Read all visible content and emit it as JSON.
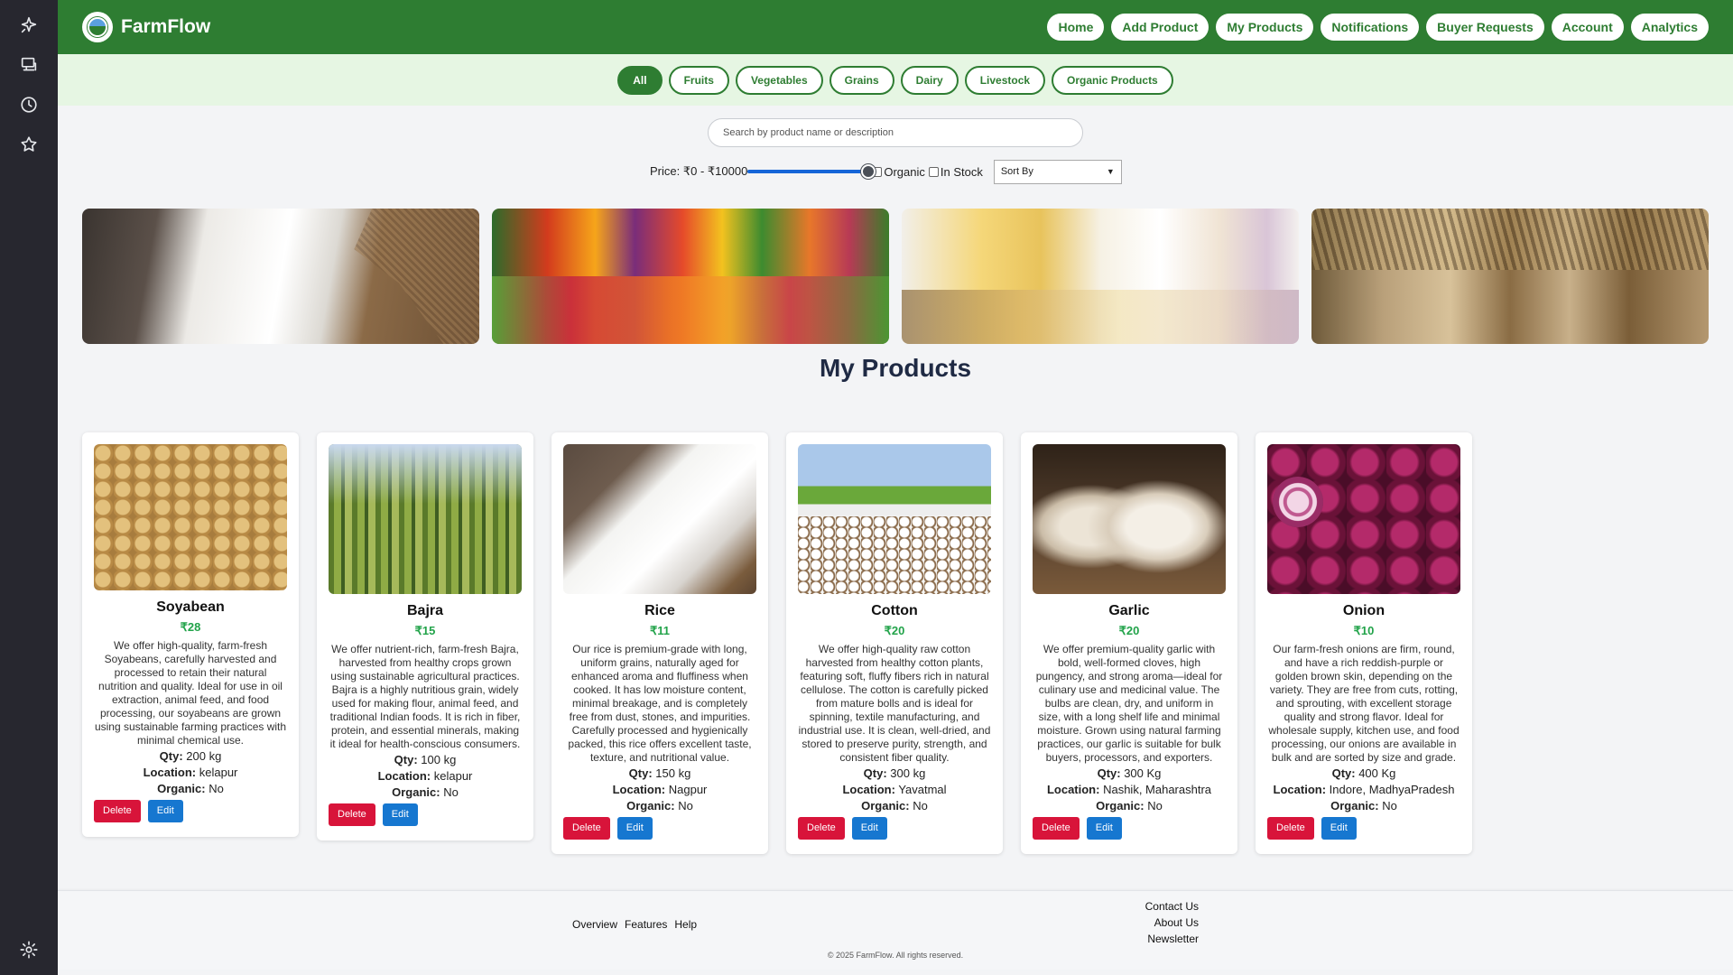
{
  "rail": {
    "icons": [
      "sparkle-icon",
      "monitor-icon",
      "clock-icon",
      "star-icon",
      "gear-icon"
    ]
  },
  "header": {
    "brand": "FarmFlow",
    "nav": [
      "Home",
      "Add Product",
      "My Products",
      "Notifications",
      "Buyer Requests",
      "Account",
      "Analytics"
    ]
  },
  "categories": {
    "items": [
      "All",
      "Fruits",
      "Vegetables",
      "Grains",
      "Dairy",
      "Livestock",
      "Organic Products"
    ],
    "active": "All"
  },
  "search": {
    "placeholder": "Search by product name or description"
  },
  "filters": {
    "price_label": "Price: ₹0 - ₹10000",
    "price_slider_value_fraction": 1.0,
    "organic_label": "Organic",
    "organic_checked": false,
    "instock_label": "In Stock",
    "instock_checked": false,
    "sort_value": "Sort By"
  },
  "banners": [
    "rice",
    "vegetables",
    "dairy",
    "grains"
  ],
  "page_title": "My Products",
  "products": [
    {
      "name": "Soyabean",
      "price": "₹28",
      "description": "We offer high-quality, farm-fresh Soyabeans, carefully harvested and processed to retain their natural nutrition and quality. Ideal for use in oil extraction, animal feed, and food processing, our soyabeans are grown using sustainable farming practices with minimal chemical use.",
      "qty_label": "Qty:",
      "qty": "200 kg",
      "location_label": "Location:",
      "location": "kelapur",
      "organic_label": "Organic:",
      "organic": "No"
    },
    {
      "name": "Bajra",
      "price": "₹15",
      "description": "We offer nutrient-rich, farm-fresh Bajra, harvested from healthy crops grown using sustainable agricultural practices. Bajra is a highly nutritious grain, widely used for making flour, animal feed, and traditional Indian foods. It is rich in fiber, protein, and essential minerals, making it ideal for health-conscious consumers.",
      "qty_label": "Qty:",
      "qty": "100 kg",
      "location_label": "Location:",
      "location": "kelapur",
      "organic_label": "Organic:",
      "organic": "No"
    },
    {
      "name": "Rice",
      "price": "₹11",
      "description": "Our rice is premium-grade with long, uniform grains, naturally aged for enhanced aroma and fluffiness when cooked. It has low moisture content, minimal breakage, and is completely free from dust, stones, and impurities. Carefully processed and hygienically packed, this rice offers excellent taste, texture, and nutritional value.",
      "qty_label": "Qty:",
      "qty": "150 kg",
      "location_label": "Location:",
      "location": "Nagpur",
      "organic_label": "Organic:",
      "organic": "No"
    },
    {
      "name": "Cotton",
      "price": "₹20",
      "description": "We offer high-quality raw cotton harvested from healthy cotton plants, featuring soft, fluffy fibers rich in natural cellulose. The cotton is carefully picked from mature bolls and is ideal for spinning, textile manufacturing, and industrial use. It is clean, well-dried, and stored to preserve purity, strength, and consistent fiber quality.",
      "qty_label": "Qty:",
      "qty": "300 kg",
      "location_label": "Location:",
      "location": "Yavatmal",
      "organic_label": "Organic:",
      "organic": "No"
    },
    {
      "name": "Garlic",
      "price": "₹20",
      "description": "We offer premium-quality garlic with bold, well-formed cloves, high pungency, and strong aroma—ideal for culinary use and medicinal value. The bulbs are clean, dry, and uniform in size, with a long shelf life and minimal moisture. Grown using natural farming practices, our garlic is suitable for bulk buyers, processors, and exporters.",
      "qty_label": "Qty:",
      "qty": "300 Kg",
      "location_label": "Location:",
      "location": "Nashik, Maharashtra",
      "organic_label": "Organic:",
      "organic": "No"
    },
    {
      "name": "Onion",
      "price": "₹10",
      "description": "Our farm-fresh onions are firm, round, and have a rich reddish-purple or golden brown skin, depending on the variety. They are free from cuts, rotting, and sprouting, with excellent storage quality and strong flavor. Ideal for wholesale supply, kitchen use, and food processing, our onions are available in bulk and are sorted by size and grade.",
      "qty_label": "Qty:",
      "qty": "400 Kg",
      "location_label": "Location:",
      "location": "Indore, MadhyaPradesh",
      "organic_label": "Organic:",
      "organic": "No"
    }
  ],
  "buttons": {
    "delete": "Delete",
    "edit": "Edit"
  },
  "footer": {
    "links_left": [
      "Overview",
      "Features",
      "Help"
    ],
    "links_right": [
      "Contact Us",
      "About Us",
      "Newsletter"
    ],
    "copyright": "© 2025 FarmFlow. All rights reserved."
  },
  "colors": {
    "brand_green": "#2e7d32",
    "price_green": "#22a34a",
    "delete_red": "#d8143a",
    "edit_blue": "#1677d0",
    "rail_dark": "#27272f"
  }
}
